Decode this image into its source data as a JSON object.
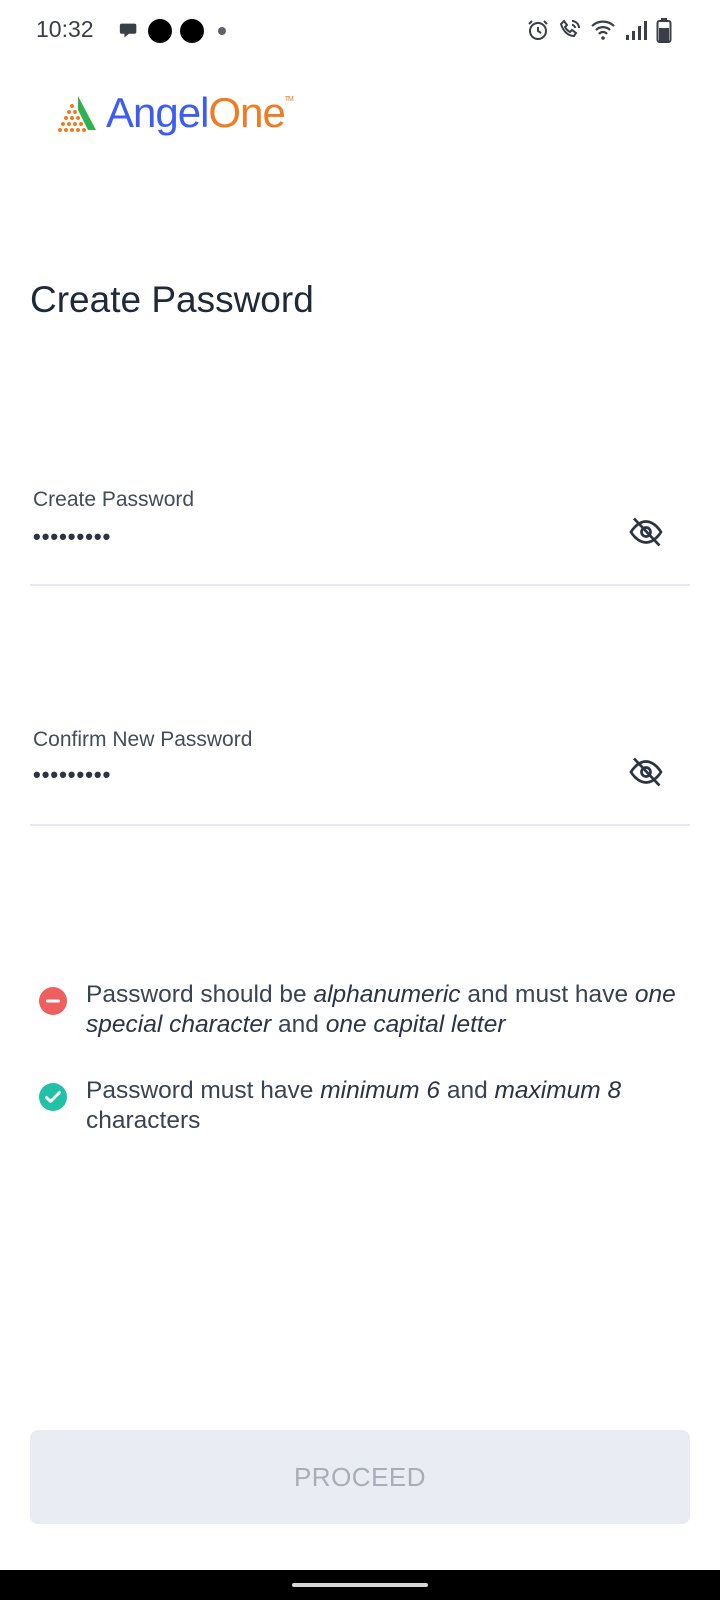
{
  "status_bar": {
    "time": "10:32"
  },
  "logo": {
    "part1": "Angel",
    "part2": "One",
    "tm": "TM"
  },
  "page": {
    "title": "Create Password"
  },
  "fields": {
    "create": {
      "label": "Create Password",
      "value": "•••••••••"
    },
    "confirm": {
      "label": "Confirm New Password",
      "value": "•••••••••"
    }
  },
  "rules": [
    {
      "status": "unmet",
      "t1": "Password should be ",
      "i1": "alphanumeric",
      "t2": " and must have ",
      "i2": "one special character",
      "t3": " and ",
      "i3": "one capital letter",
      "t4": ""
    },
    {
      "status": "met",
      "t1": "Password must have ",
      "i1": "minimum 6",
      "t2": " and ",
      "i2": "maximum 8",
      "t3": " characters",
      "i3": "",
      "t4": ""
    }
  ],
  "actions": {
    "proceed": "PROCEED"
  },
  "colors": {
    "brand_blue": "#3d5cf5",
    "brand_orange": "#ef7b22",
    "error_red": "#ef5f5f",
    "success_teal": "#21c1a6",
    "disabled_button_bg": "#e9ecf2",
    "disabled_button_text": "#a7adb9"
  }
}
